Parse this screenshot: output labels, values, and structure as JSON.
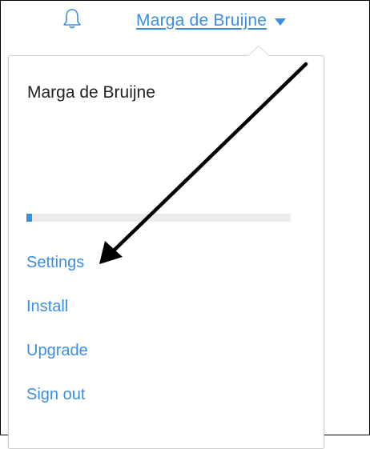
{
  "header": {
    "user_name": "Marga de Bruijne",
    "accent_color": "#3b8ee6",
    "bell_icon": "bell-icon",
    "caret_icon": "caret-down-icon"
  },
  "dropdown": {
    "profile_name": "Marga de Bruijne",
    "storage_used_fraction": 0.02,
    "menu": [
      {
        "label": "Settings"
      },
      {
        "label": "Install"
      },
      {
        "label": "Upgrade"
      },
      {
        "label": "Sign out"
      }
    ]
  },
  "annotation": {
    "type": "arrow",
    "color": "#000000",
    "points_to": "Settings"
  }
}
